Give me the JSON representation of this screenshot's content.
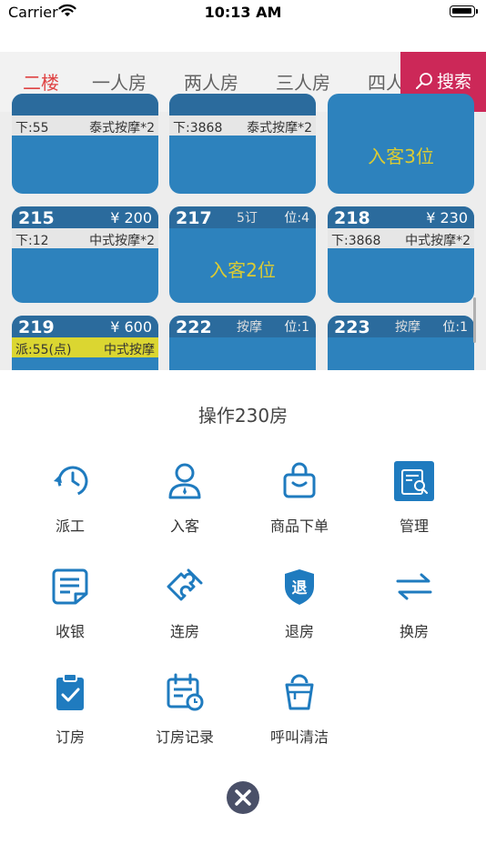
{
  "status_bar": {
    "carrier": "Carrier",
    "time": "10:13 AM"
  },
  "tabs": [
    {
      "label": "二楼",
      "active": true
    },
    {
      "label": "一人房",
      "active": false
    },
    {
      "label": "两人房",
      "active": false
    },
    {
      "label": "三人房",
      "active": false
    },
    {
      "label": "四人房",
      "active": false
    }
  ],
  "search": {
    "label": "搜索"
  },
  "rooms_top": [
    {
      "left": "下:55",
      "right": "泰式按摩*2"
    },
    {
      "left": "下:3868",
      "right": "泰式按摩*2"
    },
    {
      "center": "入客3位"
    }
  ],
  "rooms_mid": [
    {
      "number": "215",
      "price": "¥ 200",
      "left": "下:12",
      "right": "中式按摩*2"
    },
    {
      "number": "217",
      "mid": "5订",
      "pos": "位:4",
      "center": "入客2位"
    },
    {
      "number": "218",
      "price": "¥ 230",
      "left": "下:3868",
      "right": "中式按摩*2"
    }
  ],
  "rooms_bottom": [
    {
      "number": "219",
      "price": "¥ 600",
      "left": "派:55(点)",
      "right": "中式按摩"
    },
    {
      "number": "222",
      "mid": "按摩",
      "pos": "位:1"
    },
    {
      "number": "223",
      "mid": "按摩",
      "pos": "位:1"
    }
  ],
  "sheet": {
    "title": "操作230房",
    "actions": [
      {
        "label": "派工",
        "icon": "dispatch-clock-icon"
      },
      {
        "label": "入客",
        "icon": "guest-user-icon"
      },
      {
        "label": "商品下单",
        "icon": "shopping-bag-icon"
      },
      {
        "label": "管理",
        "icon": "manage-doc-icon"
      },
      {
        "label": "收银",
        "icon": "cashier-note-icon"
      },
      {
        "label": "连房",
        "icon": "puzzle-icon"
      },
      {
        "label": "退房",
        "icon": "checkout-shield-icon"
      },
      {
        "label": "换房",
        "icon": "swap-arrows-icon"
      },
      {
        "label": "订房",
        "icon": "booking-clipboard-icon"
      },
      {
        "label": "订房记录",
        "icon": "booking-calendar-icon"
      },
      {
        "label": "呼叫清洁",
        "icon": "cleaning-bucket-icon"
      }
    ],
    "badge_text": "退"
  },
  "colors": {
    "accent": "#1f7bbf",
    "tab_active": "#dd3333",
    "search_bg": "#c8164a",
    "room_blue": "#1c78b8"
  }
}
